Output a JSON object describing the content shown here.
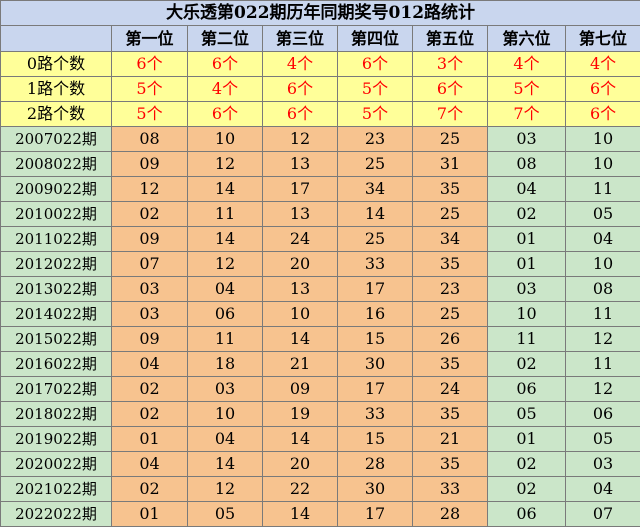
{
  "title": "大乐透第022期历年同期奖号012路统计",
  "columns": [
    "第一位",
    "第二位",
    "第三位",
    "第四位",
    "第五位",
    "第六位",
    "第七位"
  ],
  "stats": [
    {
      "label": "0路个数",
      "values": [
        "6个",
        "6个",
        "4个",
        "6个",
        "3个",
        "4个",
        "4个"
      ]
    },
    {
      "label": "1路个数",
      "values": [
        "5个",
        "4个",
        "6个",
        "5个",
        "6个",
        "5个",
        "6个"
      ]
    },
    {
      "label": "2路个数",
      "values": [
        "5个",
        "6个",
        "6个",
        "5个",
        "7个",
        "7个",
        "6个"
      ]
    }
  ],
  "rows": [
    {
      "label": "2007022期",
      "values": [
        "08",
        "10",
        "12",
        "23",
        "25",
        "03",
        "10"
      ]
    },
    {
      "label": "2008022期",
      "values": [
        "09",
        "12",
        "13",
        "25",
        "31",
        "08",
        "10"
      ]
    },
    {
      "label": "2009022期",
      "values": [
        "12",
        "14",
        "17",
        "34",
        "35",
        "04",
        "11"
      ]
    },
    {
      "label": "2010022期",
      "values": [
        "02",
        "11",
        "13",
        "14",
        "25",
        "02",
        "05"
      ]
    },
    {
      "label": "2011022期",
      "values": [
        "09",
        "14",
        "24",
        "25",
        "34",
        "01",
        "04"
      ]
    },
    {
      "label": "2012022期",
      "values": [
        "07",
        "12",
        "20",
        "33",
        "35",
        "01",
        "10"
      ]
    },
    {
      "label": "2013022期",
      "values": [
        "03",
        "04",
        "13",
        "17",
        "23",
        "03",
        "08"
      ]
    },
    {
      "label": "2014022期",
      "values": [
        "03",
        "06",
        "10",
        "16",
        "25",
        "10",
        "11"
      ]
    },
    {
      "label": "2015022期",
      "values": [
        "09",
        "11",
        "14",
        "15",
        "26",
        "11",
        "12"
      ]
    },
    {
      "label": "2016022期",
      "values": [
        "04",
        "18",
        "21",
        "30",
        "35",
        "02",
        "11"
      ]
    },
    {
      "label": "2017022期",
      "values": [
        "02",
        "03",
        "09",
        "17",
        "24",
        "06",
        "12"
      ]
    },
    {
      "label": "2018022期",
      "values": [
        "02",
        "10",
        "19",
        "33",
        "35",
        "05",
        "06"
      ]
    },
    {
      "label": "2019022期",
      "values": [
        "01",
        "04",
        "14",
        "15",
        "21",
        "01",
        "05"
      ]
    },
    {
      "label": "2020022期",
      "values": [
        "04",
        "14",
        "20",
        "28",
        "35",
        "02",
        "03"
      ]
    },
    {
      "label": "2021022期",
      "values": [
        "02",
        "12",
        "22",
        "30",
        "33",
        "02",
        "04"
      ]
    },
    {
      "label": "2022022期",
      "values": [
        "01",
        "05",
        "14",
        "17",
        "28",
        "06",
        "07"
      ]
    }
  ],
  "colors": {
    "header_bg": "#c9d6ee",
    "stat_bg": "#ffff99",
    "stat_text": "#ff0000",
    "front_area_bg": "#f7c38f",
    "back_area_bg": "#cbe6c9",
    "border": "#7a7a7a"
  }
}
